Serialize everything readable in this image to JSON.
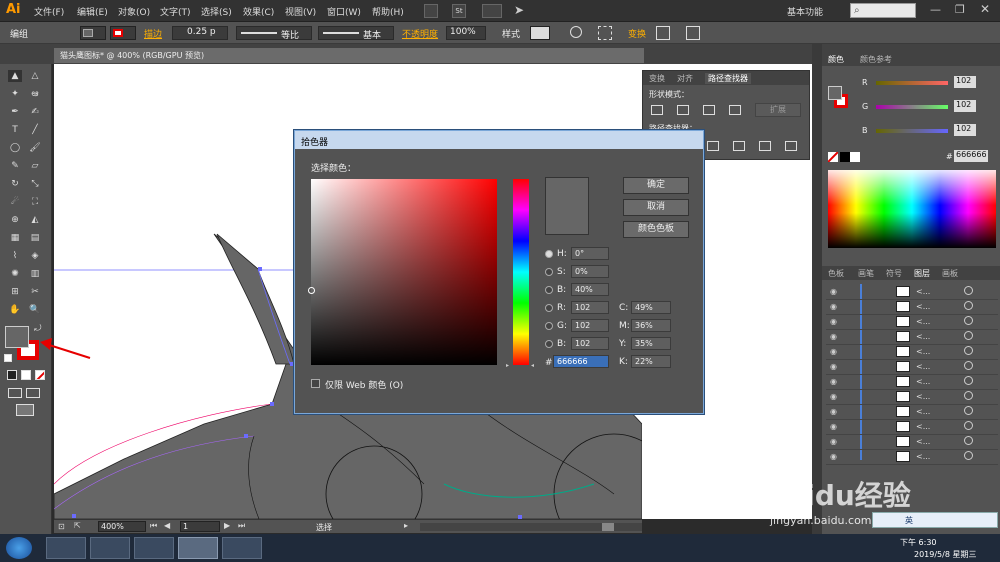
{
  "app": {
    "logo": "Ai"
  },
  "menus": [
    "文件(F)",
    "编辑(E)",
    "对象(O)",
    "文字(T)",
    "选择(S)",
    "效果(C)",
    "视图(V)",
    "窗口(W)",
    "帮助(H)"
  ],
  "workspace": {
    "label": "基本功能",
    "search_placeholder": ""
  },
  "control": {
    "mode": "编组",
    "stroke_label": "描边",
    "stroke_value": "0.25 p",
    "profile": "等比",
    "brush": "基本",
    "opacity_label": "不透明度",
    "opacity_value": "100%",
    "style_label": "样式",
    "transform_label": "变换"
  },
  "document": {
    "tab": "猫头鹰图标* @ 400% (RGB/GPU 预览)",
    "zoom": "400%",
    "page": "1",
    "status": "选择"
  },
  "path_panel": {
    "tabs": [
      "变换",
      "对齐",
      "路径查找器"
    ],
    "shape_modes": "形状模式：",
    "expand": "扩展",
    "pathfinders": "路径查找器："
  },
  "color_panel": {
    "tabs": [
      "颜色",
      "颜色参考"
    ],
    "r_label": "R",
    "r_value": "102",
    "g_label": "G",
    "g_value": "102",
    "b_label": "B",
    "b_value": "102",
    "hex": "666666"
  },
  "layers_panel": {
    "tabs": [
      "色板",
      "画笔",
      "符号",
      "图层",
      "画板"
    ],
    "row_label": "<..."
  },
  "picker": {
    "title": "拾色器",
    "select_label": "选择颜色：",
    "ok": "确定",
    "cancel": "取消",
    "swatches": "颜色色板",
    "h_label": "H:",
    "h_value": "0°",
    "s_label": "S:",
    "s_value": "0%",
    "b_label": "B:",
    "b_value": "40%",
    "r_label": "R:",
    "r_value": "102",
    "g_label": "G:",
    "g_value": "102",
    "bb_label": "B:",
    "bb_value": "102",
    "c_label": "C:",
    "c_value": "49%",
    "m_label": "M:",
    "m_value": "36%",
    "y_label": "Y:",
    "y_value": "35%",
    "k_label": "K:",
    "k_value": "22%",
    "hash": "#",
    "hex_value": "666666",
    "web_only": "仅限 Web 颜色 (O)",
    "current_color": "#666666"
  },
  "taskbar": {
    "time": "下午 6:30",
    "date": "2019/5/8 星期三",
    "ime": "英"
  },
  "watermark": {
    "brand": "Baidu经验",
    "url": "jingyan.baidu.com"
  },
  "colors": {
    "fill": "#666666",
    "accent": "#ff9a00",
    "stroke": "#e60000"
  }
}
